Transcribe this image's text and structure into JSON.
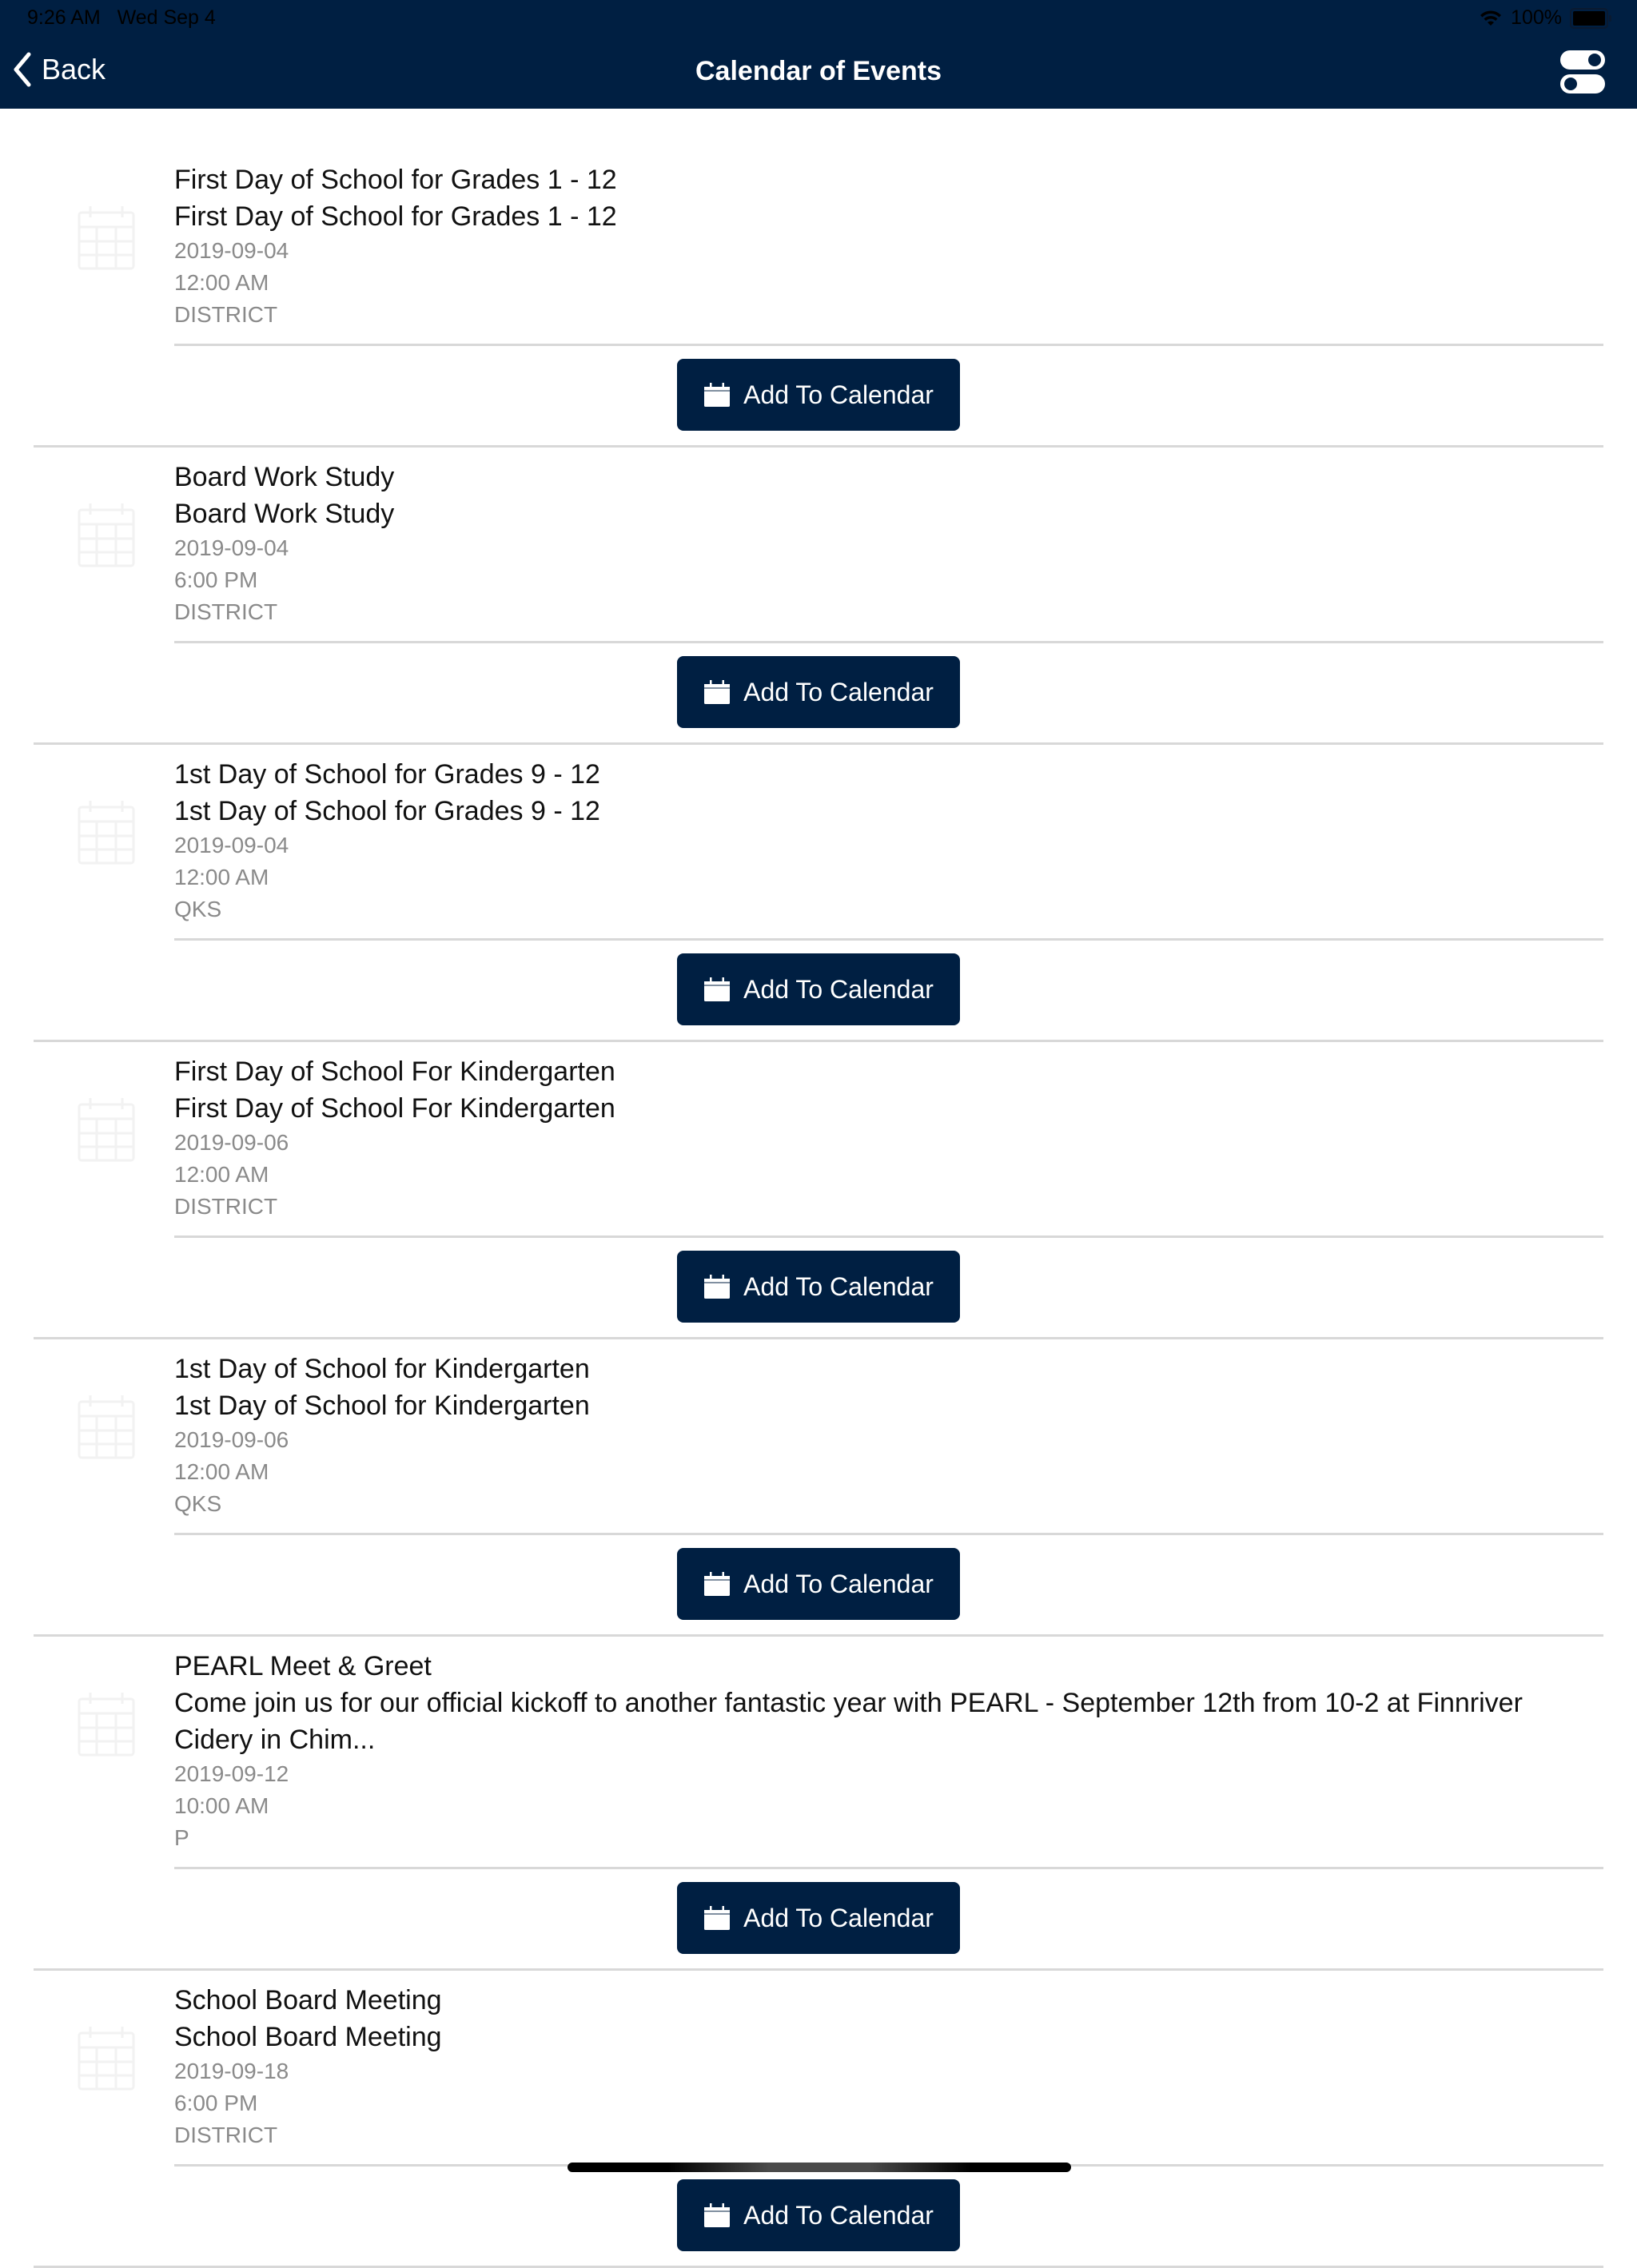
{
  "status_bar": {
    "time": "9:26 AM",
    "date": "Wed Sep 4",
    "battery": "100%",
    "battery_level": 1.0,
    "wifi_icon": "wifi-icon",
    "battery_icon": "battery-icon"
  },
  "nav": {
    "back_label": "Back",
    "back_icon": "chevron-left-icon",
    "title": "Calendar of Events",
    "settings_icon": "toggles-icon"
  },
  "colors": {
    "brand": "#001f42",
    "meta_text": "#8a8a8a",
    "separator": "#d8d8d8"
  },
  "add_button_label": "Add To Calendar",
  "events": [
    {
      "title": "First Day of School for Grades 1 - 12",
      "description": "First Day of School for Grades 1 - 12",
      "date": "2019-09-04",
      "time": "12:00 AM",
      "category": "DISTRICT",
      "button_label": "Add To Calendar"
    },
    {
      "title": "Board Work Study",
      "description": "Board Work Study",
      "date": "2019-09-04",
      "time": "6:00 PM",
      "category": "DISTRICT",
      "button_label": "Add To Calendar"
    },
    {
      "title": "1st Day of School for Grades 9 - 12",
      "description": "1st Day of School for Grades 9 - 12",
      "date": "2019-09-04",
      "time": "12:00 AM",
      "category": "QKS",
      "button_label": "Add To Calendar"
    },
    {
      "title": "First Day of School For Kindergarten",
      "description": "First Day of School For Kindergarten",
      "date": "2019-09-06",
      "time": "12:00 AM",
      "category": "DISTRICT",
      "button_label": "Add To Calendar"
    },
    {
      "title": "1st Day of School for Kindergarten",
      "description": "1st Day of School for Kindergarten",
      "date": "2019-09-06",
      "time": "12:00 AM",
      "category": "QKS",
      "button_label": "Add To Calendar"
    },
    {
      "title": "PEARL Meet & Greet",
      "description": "Come join us for our official kickoff to another fantastic year with PEARL - September 12th from 10-2 at Finnriver Cidery in Chim...",
      "date": "2019-09-12",
      "time": "10:00 AM",
      "category": "P",
      "button_label": "Add To Calendar"
    },
    {
      "title": "School Board Meeting",
      "description": "School Board Meeting",
      "date": "2019-09-18",
      "time": "6:00 PM",
      "category": "DISTRICT",
      "button_label": "Add To Calendar"
    }
  ]
}
